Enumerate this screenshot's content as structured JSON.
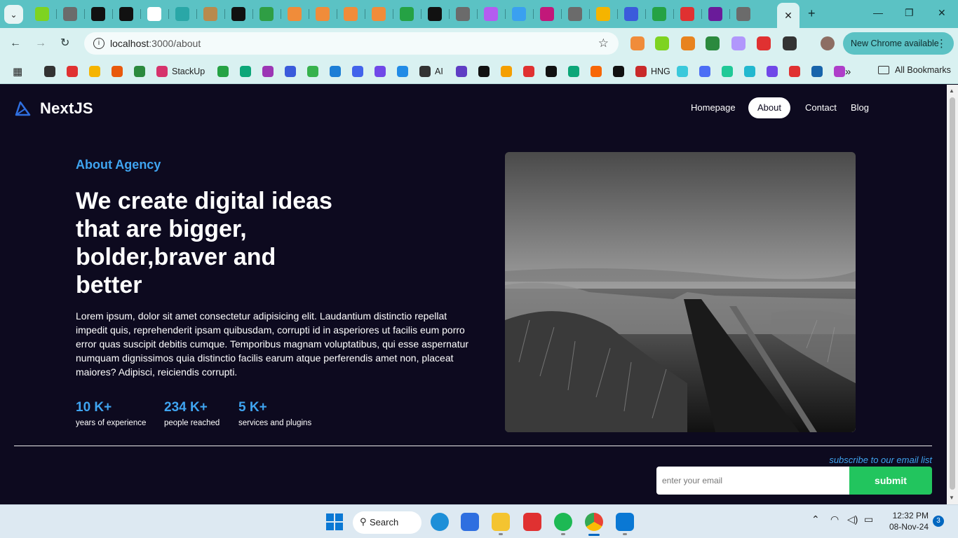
{
  "browser": {
    "tab_menu_icon": "chevron-down-icon",
    "active_tab_close": "✕",
    "new_tab": "+",
    "window_controls": {
      "minimize": "—",
      "maximize": "❐",
      "close": "✕"
    },
    "tab_favicons": [
      "#7ed321",
      "#6b6b6b",
      "#111111",
      "#111111",
      "#ffffff",
      "#2aa7a7",
      "#b88a4d",
      "#111111",
      "#2f9e44",
      "#f08c3a",
      "#f08c3a",
      "#f08c3a",
      "#f08c3a",
      "#25a244",
      "#111111",
      "#6b6b6b",
      "#b45cf0",
      "#3aa0f0",
      "#c2187a",
      "#6b6b6b",
      "#f5b400",
      "#3b5bdb",
      "#25a244",
      "#e03131",
      "#6a1b9a",
      "#6b6b6b"
    ],
    "url_host": "localhost",
    "url_path": ":3000/about",
    "extension_colors": [
      "#f08c3a",
      "#7ed321",
      "#e8831e",
      "#2b8a3e",
      "#b197fc",
      "#e03131",
      "#333333"
    ],
    "chrome_available": "New Chrome available",
    "bookmarks": [
      {
        "label": "",
        "color": "#333333"
      },
      {
        "label": "",
        "color": "#e03131"
      },
      {
        "label": "",
        "color": "#f5b400"
      },
      {
        "label": "",
        "color": "#e8590c"
      },
      {
        "label": "",
        "color": "#2b8a3e"
      },
      {
        "label": "StackUp",
        "color": "#d6336c"
      },
      {
        "label": "",
        "color": "#25a244"
      },
      {
        "label": "",
        "color": "#0ca678"
      },
      {
        "label": "",
        "color": "#9c36b5"
      },
      {
        "label": "",
        "color": "#3b5bdb"
      },
      {
        "label": "",
        "color": "#37b24d"
      },
      {
        "label": "",
        "color": "#1c7ed6"
      },
      {
        "label": "",
        "color": "#4263eb"
      },
      {
        "label": "",
        "color": "#7048e8"
      },
      {
        "label": "",
        "color": "#228be6"
      },
      {
        "label": "AI",
        "color": "#333333"
      },
      {
        "label": "",
        "color": "#5f3dc4"
      },
      {
        "label": "",
        "color": "#111111"
      },
      {
        "label": "",
        "color": "#f59f00"
      },
      {
        "label": "",
        "color": "#e03131"
      },
      {
        "label": "",
        "color": "#111111"
      },
      {
        "label": "",
        "color": "#0ca678"
      },
      {
        "label": "",
        "color": "#f76707"
      },
      {
        "label": "",
        "color": "#111111"
      },
      {
        "label": "HNG",
        "color": "#c92a2a"
      },
      {
        "label": "",
        "color": "#3bc9db"
      },
      {
        "label": "",
        "color": "#4c6ef5"
      },
      {
        "label": "",
        "color": "#20c997"
      },
      {
        "label": "",
        "color": "#22b8cf"
      },
      {
        "label": "",
        "color": "#7048e8"
      },
      {
        "label": "",
        "color": "#e03131"
      },
      {
        "label": "",
        "color": "#1864ab"
      },
      {
        "label": "",
        "color": "#ae3ec9"
      }
    ],
    "bookmarks_overflow": "»",
    "all_bookmarks": "All Bookmarks"
  },
  "site": {
    "logo": "NextJS",
    "nav": [
      "Homepage",
      "About",
      "Contact",
      "Blog"
    ],
    "active_nav": "About",
    "about_label": "About Agency",
    "headline": "We create digital ideas that are bigger, bolder,braver and better",
    "description": "Lorem ipsum, dolor sit amet consectetur adipisicing elit. Laudantium distinctio repellat impedit quis, reprehenderit ipsam quibusdam, corrupti id in asperiores ut facilis eum porro error quas suscipit debitis cumque. Temporibus magnam voluptatibus, qui esse aspernatur numquam dignissimos quia distinctio facilis earum atque perferendis amet non, placeat maiores? Adipisci, reiciendis corrupti.",
    "stats": [
      {
        "value": "10 K+",
        "label": "years of experience"
      },
      {
        "value": "234 K+",
        "label": "people reached"
      },
      {
        "value": "5 K+",
        "label": "services and plugins"
      }
    ],
    "subscribe_label": "subscribe to our email list",
    "email_placeholder": "enter your email",
    "submit_label": "submit",
    "accent_color": "#3fa4f0",
    "submit_color": "#22c55e"
  },
  "taskbar": {
    "search_label": "Search",
    "apps": [
      "edge-icon",
      "store-icon",
      "file-explorer-icon",
      "wps-icon",
      "spotify-icon",
      "chrome-icon",
      "vscode-icon"
    ],
    "time": "12:32 PM",
    "date": "08-Nov-24",
    "notifications": "3"
  }
}
